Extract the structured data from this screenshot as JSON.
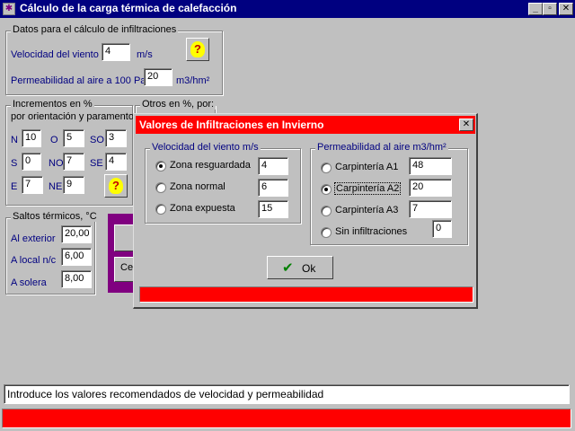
{
  "window": {
    "title": "Cálculo de la carga térmica de calefacción",
    "minimize_glyph": "_",
    "restore_glyph": "▫",
    "close_glyph": "✕"
  },
  "datos": {
    "legend": "Datos para el cálculo de infiltraciones",
    "velocidad_label": "Velocidad del viento",
    "velocidad_value": "4",
    "velocidad_unit": "m/s",
    "permeabilidad_label": "Permeabilidad al aire a 100 Pa",
    "permeabilidad_value": "20",
    "permeabilidad_unit": "m3/hm²",
    "help_glyph": "?"
  },
  "incrementos": {
    "legend": "Incrementos en %",
    "subtitle": "por orientación y paramento",
    "fields": [
      {
        "label": "N",
        "value": "10"
      },
      {
        "label": "O",
        "value": "5"
      },
      {
        "label": "SO",
        "value": "3"
      },
      {
        "label": "S",
        "value": "0"
      },
      {
        "label": "NO",
        "value": "7"
      },
      {
        "label": "SE",
        "value": "4"
      },
      {
        "label": "E",
        "value": "7"
      },
      {
        "label": "NE",
        "value": "9"
      }
    ]
  },
  "otros": {
    "legend": "Otros en %, por:"
  },
  "saltos": {
    "legend": "Saltos térmicos, °C",
    "rows": [
      {
        "label": "Al exterior",
        "value": "20,00"
      },
      {
        "label": "A local n/c",
        "value": "6,00"
      },
      {
        "label": "A solera",
        "value": "8,00"
      }
    ],
    "hidden_button_fragment": "Cer"
  },
  "dialog": {
    "title": "Valores de Infiltraciones en Invierno",
    "close_glyph": "✕",
    "velocidad": {
      "legend": "Velocidad del viento m/s",
      "options": [
        {
          "label": "Zona resguardada",
          "value": "4"
        },
        {
          "label": "Zona normal",
          "value": "6"
        },
        {
          "label": "Zona expuesta",
          "value": "15"
        }
      ],
      "selected": "Zona resguardada"
    },
    "permeabilidad": {
      "legend": "Permeabilidad al aire m3/hm²",
      "options": [
        {
          "label": "Carpintería A1",
          "value": "48"
        },
        {
          "label": "Carpintería A2",
          "value": "20"
        },
        {
          "label": "Carpintería A3",
          "value": "7"
        },
        {
          "label": "Sin infiltraciones",
          "value": "0"
        }
      ],
      "selected": "Carpintería A2"
    },
    "ok_label": "Ok",
    "ok_icon": "✔"
  },
  "status": {
    "message": "Introduce los valores recomendados de velocidad y permeabilidad"
  },
  "colors": {
    "titlebar": "#000080",
    "face": "#c0c0c0",
    "dialog_title": "#ff0000",
    "accent_purple": "#800080",
    "label_blue": "#000080"
  }
}
